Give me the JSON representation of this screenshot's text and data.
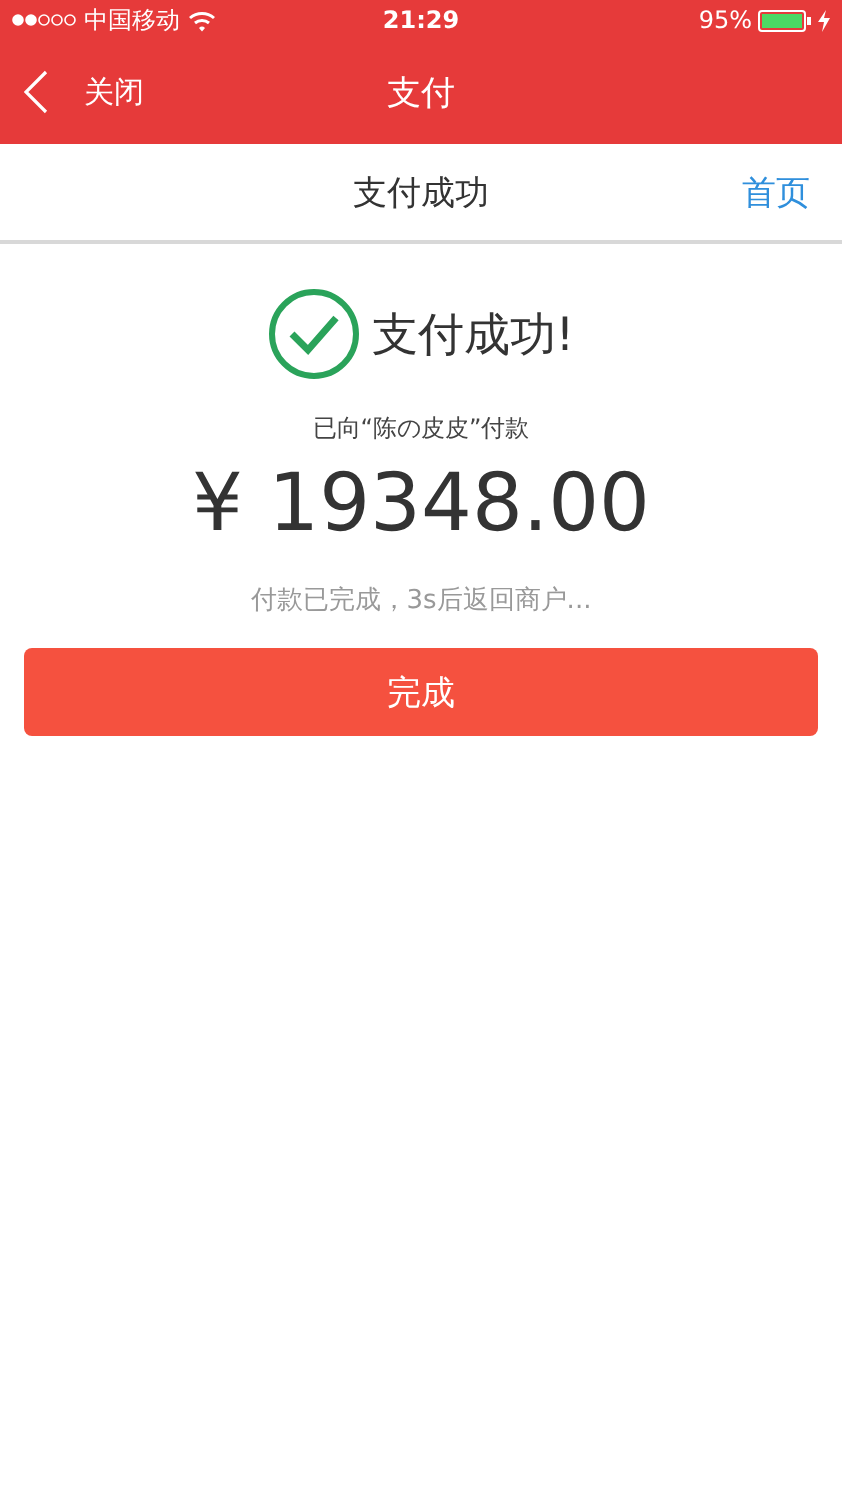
{
  "status_bar": {
    "carrier": "中国移动",
    "time": "21:29",
    "battery": "95%"
  },
  "nav_bar": {
    "back_label": "关闭",
    "title": "支付"
  },
  "header": {
    "title": "支付成功",
    "home_link": "首页"
  },
  "result": {
    "title": "支付成功!",
    "payee": "已向“陈の皮皮”付款",
    "amount": "¥ 19348.00",
    "note": "付款已完成，3s后返回商户..."
  },
  "done_button": "完成"
}
